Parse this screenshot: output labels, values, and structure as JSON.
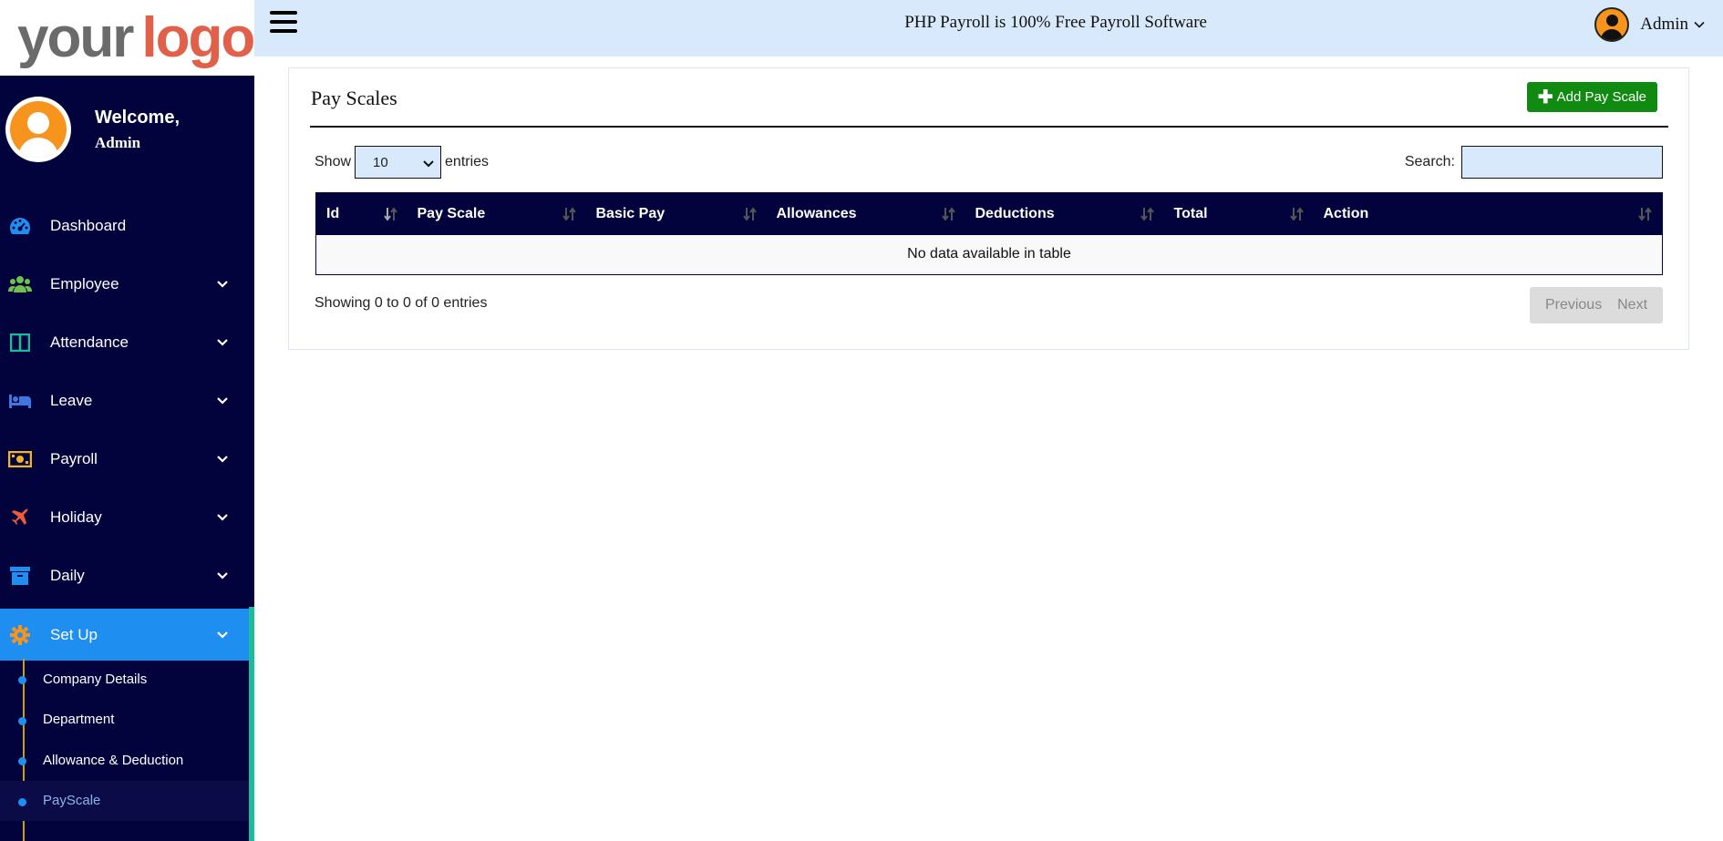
{
  "logo": {
    "part1": "your",
    "part2": "logo",
    "reg": "®"
  },
  "profile": {
    "welcome": "Welcome,",
    "name": "Admin"
  },
  "sidebar": {
    "items": [
      {
        "label": "Dashboard",
        "icon": "dashboard-gauge-icon",
        "color": "#1f8ef1",
        "has_chevron": false
      },
      {
        "label": "Employee",
        "icon": "users-icon",
        "color": "#6cc24a",
        "has_chevron": true
      },
      {
        "label": "Attendance",
        "icon": "columns-icon",
        "color": "#1abc9c",
        "has_chevron": true
      },
      {
        "label": "Leave",
        "icon": "bed-icon",
        "color": "#3e77e0",
        "has_chevron": true
      },
      {
        "label": "Payroll",
        "icon": "money-bill-icon",
        "color": "#f0b429",
        "has_chevron": true
      },
      {
        "label": "Holiday",
        "icon": "plane-icon",
        "color": "#f05a3a",
        "has_chevron": true
      },
      {
        "label": "Daily",
        "icon": "archive-box-icon",
        "color": "#1f8ef1",
        "has_chevron": true
      },
      {
        "label": "Set Up",
        "icon": "cog-icon",
        "color": "#f7941d",
        "has_chevron": true,
        "active": true
      }
    ],
    "submenu": [
      "Company Details",
      "Department",
      "Allowance & Deduction",
      "PayScale"
    ]
  },
  "header": {
    "tagline": "PHP Payroll is 100% Free Payroll Software",
    "user": "Admin"
  },
  "page": {
    "title": "Pay Scales",
    "add_button": "Add Pay Scale",
    "show_label": "Show",
    "entries_value": "10",
    "entries_label": "entries",
    "search_label": "Search:",
    "search_value": "",
    "columns": [
      "Id",
      "Pay Scale",
      "Basic Pay",
      "Allowances",
      "Deductions",
      "Total",
      "Action"
    ],
    "empty_message": "No data available in table",
    "info": "Showing 0 to 0 of 0 entries",
    "prev": "Previous",
    "next": "Next"
  },
  "colors": {
    "sidebar_bg": "#02023c",
    "header_bg": "#d7e9fb",
    "active_item": "#1f8ef1",
    "add_button": "#108a10",
    "avatar": "#f7941d"
  }
}
